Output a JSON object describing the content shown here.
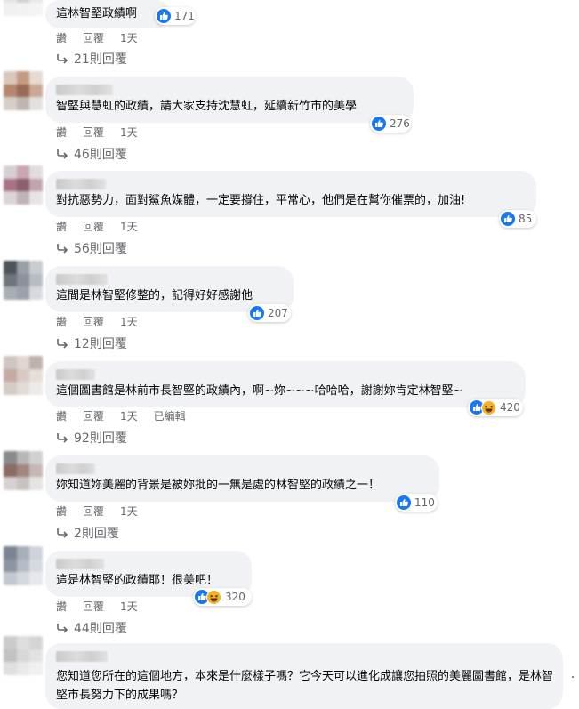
{
  "comments": [
    {
      "text": "這林智堅政績啊",
      "reactions": {
        "types": [
          "like"
        ],
        "count": "171"
      },
      "actions": [
        "讚",
        "回覆",
        "1天"
      ],
      "replies": "21則回覆",
      "avatar": [
        "#bdbdbd",
        "#d8d8d8",
        "#cfcfcf",
        "#e4e4e4",
        "#d0d0d0",
        "#e8e8e8",
        "#f0f0f0",
        "#f2f2f2",
        "#f4f4f4"
      ]
    },
    {
      "text": "智堅與慧虹的政績，請大家支持沈慧虹，延續新竹市的美學",
      "reactions": {
        "types": [
          "like"
        ],
        "count": "276"
      },
      "actions": [
        "讚",
        "回覆",
        "1天"
      ],
      "replies": "46則回覆",
      "avatar": [
        "#d9c7bd",
        "#c59a82",
        "#e6dad2",
        "#b4876e",
        "#9a6a58",
        "#c9a995",
        "#d7cec9",
        "#bfb6b2",
        "#e4e0de"
      ]
    },
    {
      "text": "對抗惡勢力，面對鯊魚媒體，一定要撐住，平常心，他們是在幫你催票的，加油!",
      "reactions": {
        "types": [
          "like"
        ],
        "count": "85"
      },
      "actions": [
        "讚",
        "回覆",
        "1天"
      ],
      "replies": "56則回覆",
      "avatar": [
        "#d6cfd6",
        "#c9a6b0",
        "#e3dbe0",
        "#a67485",
        "#8a5f6e",
        "#c2a4ad",
        "#dcd4d8",
        "#bfb3b8",
        "#e8e4e6"
      ]
    },
    {
      "text": "這間是林智堅修整的，記得好好感謝他",
      "reactions": {
        "types": [
          "like"
        ],
        "count": "207"
      },
      "actions": [
        "讚",
        "回覆",
        "1天"
      ],
      "replies": "12則回覆",
      "avatar": [
        "#4d545a",
        "#9aa0a8",
        "#c9ccd0",
        "#6e747a",
        "#8d929a",
        "#b8bcc2",
        "#a9adb4",
        "#9ca1aa",
        "#d7d9dc"
      ]
    },
    {
      "text": "這個圖書館是林前市長智堅的政績內，啊~妳~~~哈哈哈，謝謝妳肯定林智堅~",
      "reactions": {
        "types": [
          "like",
          "haha"
        ],
        "count": "420"
      },
      "actions": [
        "讚",
        "回覆",
        "1天",
        "已編輯"
      ],
      "replies": "92則回覆",
      "avatar": [
        "#cfc6c2",
        "#e0d7d2",
        "#bfb2ad",
        "#c5aaa1",
        "#d8c9c3",
        "#e6dcd8",
        "#d4cac6",
        "#e2dad6",
        "#eeeae8"
      ]
    },
    {
      "text": "妳知道妳美麗的背景是被妳批的一無是處的林智堅的政績之一！",
      "reactions": {
        "types": [
          "like"
        ],
        "count": "110"
      },
      "actions": [
        "讚",
        "回覆",
        "1天"
      ],
      "replies": "2則回覆",
      "avatar": [
        "#8a8a8a",
        "#b7b7b7",
        "#d1d1d1",
        "#8c6b63",
        "#a1877f",
        "#c5b7b2",
        "#d7d1cf",
        "#c8c2c0",
        "#e6e3e2"
      ]
    },
    {
      "text": "這是林智堅的政績耶！很美吧！",
      "reactions": {
        "types": [
          "like",
          "haha"
        ],
        "count": "320"
      },
      "actions": [
        "讚",
        "回覆",
        "1天"
      ],
      "replies": "44則回覆",
      "avatar": [
        "#7b8592",
        "#a7afba",
        "#cfd4da",
        "#8d95a1",
        "#b6bcc5",
        "#d6dae0",
        "#c3c8cf",
        "#d4d8dd",
        "#e6e8eb"
      ]
    },
    {
      "text": "您知道您所在的這個地方，本來是什麼樣子嗎？它今天可以進化成讓您拍照的美麗圖書館，是林智堅市長努力下的成果嗎？",
      "avatar": [
        "#cbcbcb",
        "#dedede",
        "#d5d5d5",
        "#c2c2c2",
        "#d8d8d8",
        "#e2e2e2",
        "#e0e0e0",
        "#e9e9e9",
        "#f0f0f0"
      ]
    }
  ]
}
